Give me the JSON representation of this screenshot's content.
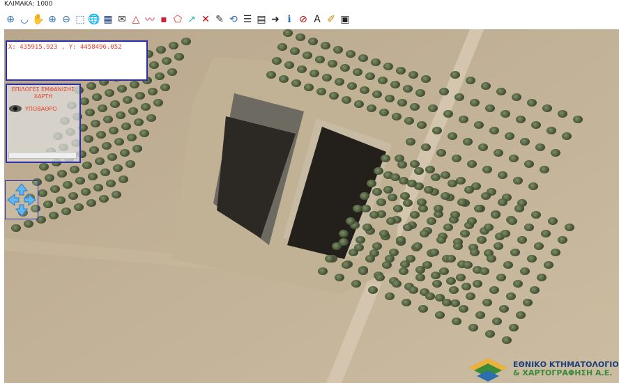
{
  "scale": {
    "label": "ΚΛΙΜΑΚΑ: 1000"
  },
  "toolbar": {
    "tools": [
      {
        "name": "pan-select-icon",
        "glyph": "⊕"
      },
      {
        "name": "arc-icon",
        "glyph": "◡"
      },
      {
        "name": "hand-pan-icon",
        "glyph": "✋"
      },
      {
        "name": "zoom-in-icon",
        "glyph": "⊕"
      },
      {
        "name": "zoom-out-icon",
        "glyph": "⊖"
      },
      {
        "name": "zoom-extent-icon",
        "glyph": "⬚"
      },
      {
        "name": "globe-icon",
        "glyph": "🌐"
      },
      {
        "name": "layers-grid-icon",
        "glyph": "▦"
      },
      {
        "name": "envelope-icon",
        "glyph": "✉"
      },
      {
        "name": "polygon-icon",
        "glyph": "△"
      },
      {
        "name": "polyline-icon",
        "glyph": "〰"
      },
      {
        "name": "point-icon",
        "glyph": "▪"
      },
      {
        "name": "polygon-xy-icon",
        "glyph": "⬠"
      },
      {
        "name": "measure-icon",
        "glyph": "↗"
      },
      {
        "name": "clear-icon",
        "glyph": "✕"
      },
      {
        "name": "edit-pen-icon",
        "glyph": "✎"
      },
      {
        "name": "refresh-icon",
        "glyph": "⟲"
      },
      {
        "name": "document-icon",
        "glyph": "☰"
      },
      {
        "name": "xy-table-icon",
        "glyph": "▤"
      },
      {
        "name": "xy-goto-icon",
        "glyph": "➜"
      },
      {
        "name": "info-icon",
        "glyph": "ℹ"
      },
      {
        "name": "no-layer-icon",
        "glyph": "⊘"
      },
      {
        "name": "text-label-icon",
        "glyph": "A"
      },
      {
        "name": "highlighter-icon",
        "glyph": "✐"
      },
      {
        "name": "screenshot-icon",
        "glyph": "▣"
      }
    ]
  },
  "coords": {
    "text": "X: 435915.923 , Y: 4458496.052"
  },
  "layers": {
    "title": "ΕΠΙΛΟΓΕΣ ΕΜΦΑΝΙΣΗΣ ΧΑΡΤΗ",
    "item_label": "ΥΠΟΒΑΘΡΟ"
  },
  "logo": {
    "line1": "ΕΘΝΙΚΟ ΚΤΗΜΑΤΟΛΟΓΙΟ",
    "line2": "& ΧΑΡΤΟΓΡΑΦΗΣΗ Α.Ε."
  },
  "colors": {
    "panel_border": "#2b2fa6",
    "accent_text": "#e8412a",
    "logo_blue": "#1d3f7a",
    "logo_green": "#3a8a3a"
  }
}
